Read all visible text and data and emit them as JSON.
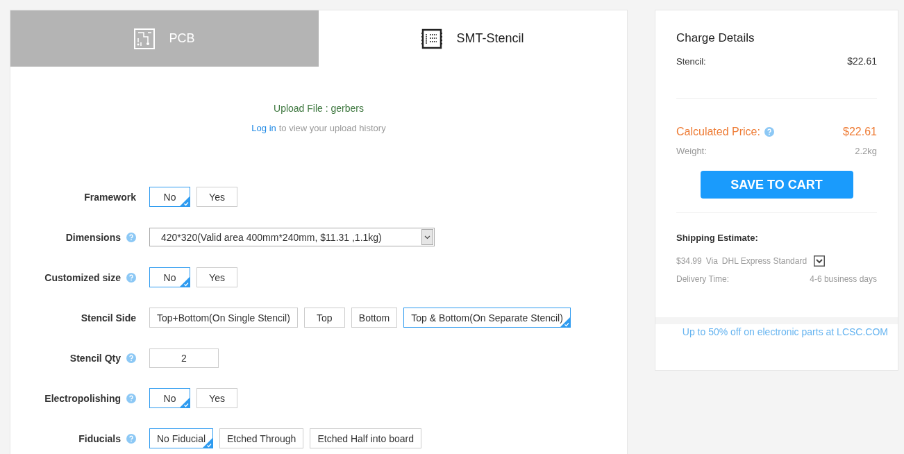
{
  "tabs": [
    {
      "label": "PCB",
      "kind": "pcb",
      "selected": false
    },
    {
      "label": "SMT-Stencil",
      "kind": "stencil",
      "selected": true
    }
  ],
  "upload": {
    "file": "Upload File : gerbers",
    "login_link": "Log in",
    "login_text": "to view your upload history"
  },
  "options": [
    {
      "label": "Framework",
      "help": false,
      "kind": "choices",
      "choices": [
        {
          "label": "No",
          "selected": true
        },
        {
          "label": "Yes",
          "selected": false
        }
      ]
    },
    {
      "label": "Dimensions",
      "help": true,
      "kind": "select",
      "value": "420*320(Valid area 400mm*240mm, $11.31 ,1.1kg)"
    },
    {
      "label": "Customized size",
      "help": true,
      "kind": "choices",
      "choices": [
        {
          "label": "No",
          "selected": true
        },
        {
          "label": "Yes",
          "selected": false
        }
      ]
    },
    {
      "label": "Stencil Side",
      "help": false,
      "kind": "choices",
      "choices": [
        {
          "label": "Top+Bottom(On Single Stencil)",
          "selected": false
        },
        {
          "label": "Top",
          "selected": false
        },
        {
          "label": "Bottom",
          "selected": false
        },
        {
          "label": "Top & Bottom(On Separate Stencil)",
          "selected": true
        }
      ]
    },
    {
      "label": "Stencil Qty",
      "help": true,
      "kind": "input",
      "value": "2"
    },
    {
      "label": "Electropolishing",
      "help": true,
      "kind": "choices",
      "choices": [
        {
          "label": "No",
          "selected": true
        },
        {
          "label": "Yes",
          "selected": false
        }
      ]
    },
    {
      "label": "Fiducials",
      "help": true,
      "kind": "choices",
      "choices": [
        {
          "label": "No Fiducial",
          "selected": true
        },
        {
          "label": "Etched Through",
          "selected": false
        },
        {
          "label": "Etched Half into board",
          "selected": false
        }
      ]
    }
  ],
  "charge": {
    "title": "Charge Details",
    "stencil_label": "Stencil:",
    "stencil_value": "$22.61",
    "price_label": "Calculated Price:",
    "price_value": "$22.61",
    "weight_label": "Weight:",
    "weight_value": "2.2kg",
    "save_button": "SAVE TO CART",
    "shipping_title": "Shipping Estimate:",
    "shipping_cost": "$34.99",
    "shipping_via": "Via",
    "shipping_method": "DHL Express Standard",
    "delivery_label": "Delivery Time:",
    "delivery_value": "4-6 business days",
    "promo": "Up to 50% off on electronic parts at LCSC.COM"
  }
}
